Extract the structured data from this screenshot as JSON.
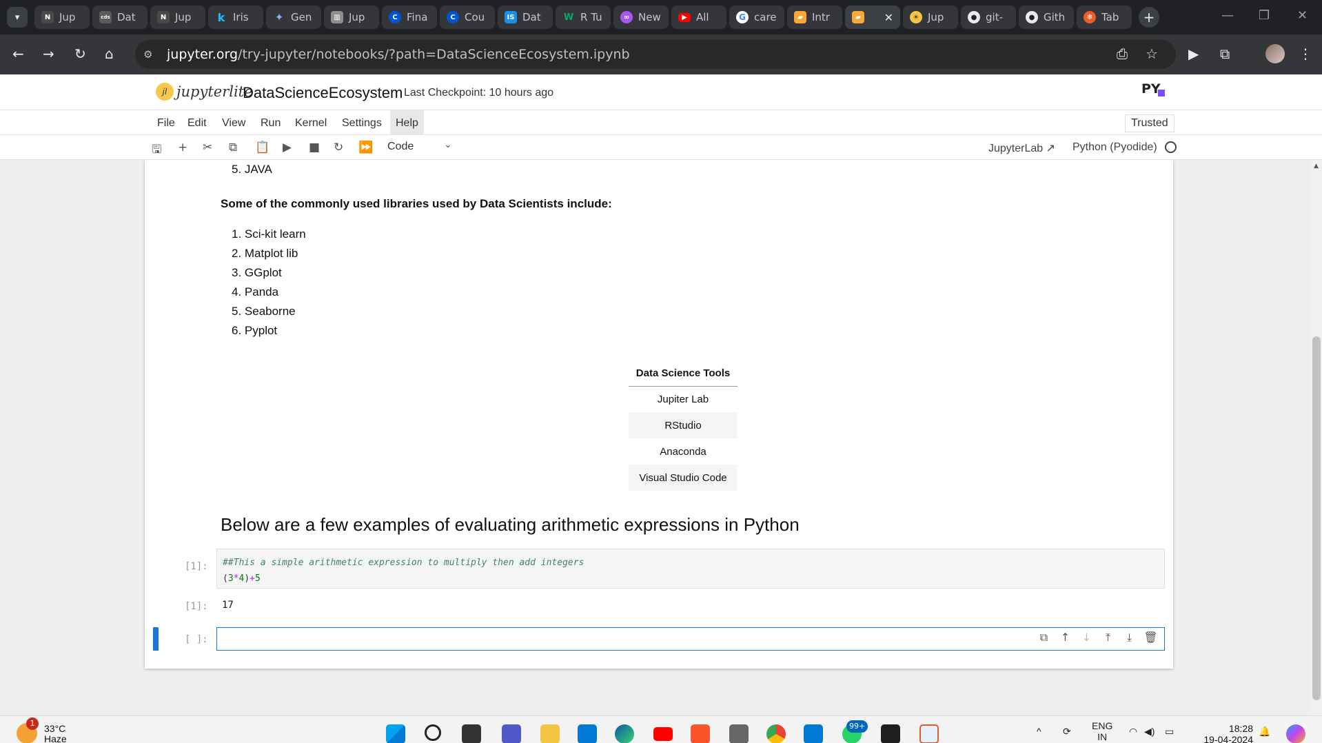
{
  "browser": {
    "tabs": [
      {
        "label": "Jup",
        "icon": "notebook-icon",
        "color": "#4a4a4a"
      },
      {
        "label": "Dat",
        "icon": "cds-icon",
        "color": "#5b5b5b"
      },
      {
        "label": "Jup",
        "icon": "notebook-icon",
        "color": "#4a4a4a"
      },
      {
        "label": "Iris",
        "icon": "kaggle-k-icon",
        "color": "#20beff"
      },
      {
        "label": "Gen",
        "icon": "gemini-star-icon",
        "color": "#6b8cff"
      },
      {
        "label": "Jup",
        "icon": "book-icon",
        "color": "#8e8e8e"
      },
      {
        "label": "Fina",
        "icon": "coursera-icon",
        "color": "#0056d2"
      },
      {
        "label": "Cou",
        "icon": "coursera-icon",
        "color": "#0056d2"
      },
      {
        "label": "Dat",
        "icon": "skillsnetwork-icon",
        "color": "#1b8ee8"
      },
      {
        "label": "R Tu",
        "icon": "w3-icon",
        "color": "#04aa6d"
      },
      {
        "label": "New",
        "icon": "copilot-icon",
        "color": "#a855f7"
      },
      {
        "label": "All",
        "icon": "youtube-icon",
        "color": "#ff0000"
      },
      {
        "label": "care",
        "icon": "google-icon",
        "color": "#ffffff"
      },
      {
        "label": "Intr",
        "icon": "jupyterlite-icon",
        "color": "#f7a836"
      },
      {
        "label": "",
        "icon": "jupyterlite-icon",
        "color": "#f7a836",
        "active": true
      },
      {
        "label": "Jup",
        "icon": "bulb-icon",
        "color": "#f5c542"
      },
      {
        "label": "git-",
        "icon": "github-icon",
        "color": "#e8eaed"
      },
      {
        "label": "Gith",
        "icon": "github-icon",
        "color": "#e8eaed"
      },
      {
        "label": "Tab",
        "icon": "tableau-icon",
        "color": "#f15a24"
      }
    ],
    "url_host": "jupyter.org",
    "url_path": "/try-jupyter/notebooks/?path=DataScienceEcosystem.ipynb"
  },
  "header": {
    "logo_text": "jupyterlite",
    "notebook_title": "DataScienceEcosystem",
    "checkpoint": "Last Checkpoint: 10 hours ago",
    "py_logo": "PY"
  },
  "menu": {
    "items": [
      "File",
      "Edit",
      "View",
      "Run",
      "Kernel",
      "Settings",
      "Help"
    ],
    "trusted": "Trusted"
  },
  "toolbar": {
    "cell_type": "Code",
    "jupyterlab_link": "JupyterLab",
    "kernel_name": "Python (Pyodide)"
  },
  "notebook": {
    "language_last": "5. JAVA",
    "libraries_heading": "Some of the commonly used libraries used by Data Scientists include:",
    "libraries": [
      "1. Sci-kit learn",
      "2. Matplot lib",
      "3. GGplot",
      "4. Panda",
      "5. Seaborne",
      "6. Pyplot"
    ],
    "tools_header": "Data Science Tools",
    "tools": [
      "Jupiter Lab",
      "RStudio",
      "Anaconda",
      "Visual Studio Code"
    ],
    "arith_heading": "Below are a few examples of evaluating arithmetic expressions in Python",
    "code_prompt": "[1]:",
    "code_comment": "##This a simple arithmetic expression to multiply then add integers",
    "code_open": "(",
    "code_num1": "3",
    "code_op1": "*",
    "code_num2": "4",
    "code_close": ")",
    "code_op2": "+",
    "code_num3": "5",
    "output_prompt": "[1]:",
    "output_value": "17",
    "empty_prompt": "[ ]:"
  },
  "taskbar": {
    "weather_badge": "1",
    "temperature": "33°C",
    "weather_desc": "Haze",
    "notif_badge": "99+",
    "lang": "ENG",
    "lang_sub": "IN",
    "time": "18:28",
    "date": "19-04-2024"
  }
}
